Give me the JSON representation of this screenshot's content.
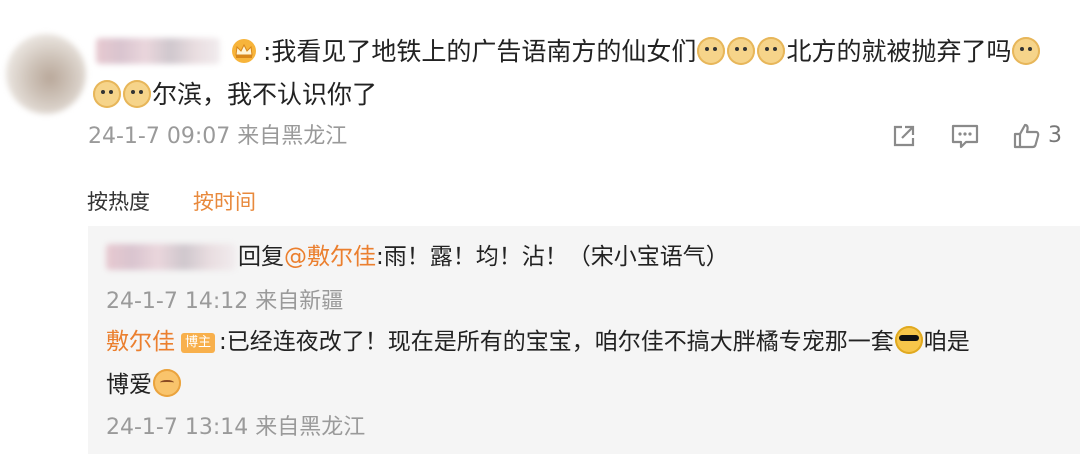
{
  "comment": {
    "text_line1": ":我看见了地铁上的广告语南方的仙女们",
    "text_line1b": "北方的就被抛弃了吗",
    "text_line2": "尔滨，我不认识你了",
    "meta": "24-1-7 09:07 来自黑龙江",
    "like_count": "3",
    "icons": [
      "share-icon",
      "comment-icon",
      "like-icon"
    ]
  },
  "sort": {
    "by_heat": "按热度",
    "by_time": "按时间",
    "active_color": "#e8893c"
  },
  "replies": [
    {
      "prefix": "回复",
      "mention": "@敷尔佳",
      "text": ":雨！露！均！沾！（宋小宝语气）",
      "meta": "24-1-7 14:12 来自新疆"
    },
    {
      "author": "敷尔佳",
      "badge": "博主",
      "text": ":已经连夜改了！现在是所有的宝宝，咱尔佳不搞大胖橘专宠那一套",
      "text_end": "咱是",
      "text_line2": "博爱",
      "meta": "24-1-7 13:14 来自黑龙江"
    }
  ],
  "colors": {
    "link": "#eb7f2e",
    "meta": "#9a9a9a",
    "reply_bg": "#f5f5f5"
  }
}
